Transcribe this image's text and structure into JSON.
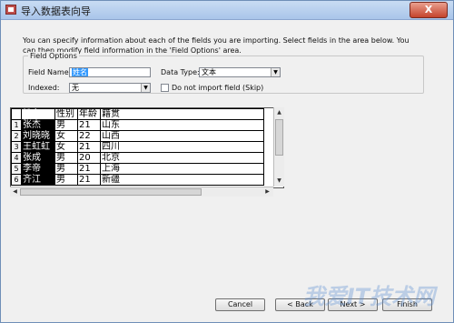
{
  "window": {
    "title": "导入数据表向导",
    "close_label": "X"
  },
  "intro_text": "You can specify information about each of the fields you are importing.  Select fields in the area below.  You can then modify field information in the 'Field Options' area.",
  "field_options": {
    "legend": "Field Options",
    "field_name_label": "Field Name:",
    "field_name_value": "姓名",
    "data_type_label": "Data Type:",
    "data_type_value": "文本",
    "indexed_label": "Indexed:",
    "indexed_value": "无",
    "skip_label": "Do not import field (Skip)"
  },
  "grid": {
    "headers": [
      "姓名",
      "性别",
      "年龄",
      "籍贯"
    ],
    "rows": [
      {
        "n": "1",
        "cells": [
          "张杰",
          "男",
          "21",
          "山东"
        ]
      },
      {
        "n": "2",
        "cells": [
          "刘晓晓",
          "女",
          "22",
          "山西"
        ]
      },
      {
        "n": "3",
        "cells": [
          "王虹虹",
          "女",
          "21",
          "四川"
        ]
      },
      {
        "n": "4",
        "cells": [
          "张成",
          "男",
          "20",
          "北京"
        ]
      },
      {
        "n": "5",
        "cells": [
          "李帝",
          "男",
          "21",
          "上海"
        ]
      },
      {
        "n": "6",
        "cells": [
          "齐江",
          "男",
          "21",
          "新疆"
        ]
      }
    ]
  },
  "buttons": {
    "cancel": "Cancel",
    "back": "< Back",
    "next": "Next >",
    "finish": "Finish"
  },
  "watermark": "我爱IT技术网"
}
